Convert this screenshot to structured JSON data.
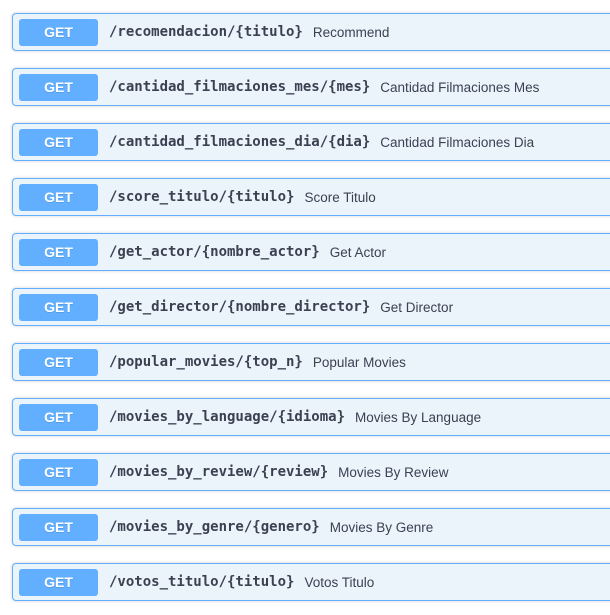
{
  "operations": [
    {
      "method": "GET",
      "path": "/recomendacion/{titulo}",
      "summary": "Recommend"
    },
    {
      "method": "GET",
      "path": "/cantidad_filmaciones_mes/{mes}",
      "summary": "Cantidad Filmaciones Mes"
    },
    {
      "method": "GET",
      "path": "/cantidad_filmaciones_dia/{dia}",
      "summary": "Cantidad Filmaciones Dia"
    },
    {
      "method": "GET",
      "path": "/score_titulo/{titulo}",
      "summary": "Score Titulo"
    },
    {
      "method": "GET",
      "path": "/get_actor/{nombre_actor}",
      "summary": "Get Actor"
    },
    {
      "method": "GET",
      "path": "/get_director/{nombre_director}",
      "summary": "Get Director"
    },
    {
      "method": "GET",
      "path": "/popular_movies/{top_n}",
      "summary": "Popular Movies"
    },
    {
      "method": "GET",
      "path": "/movies_by_language/{idioma}",
      "summary": "Movies By Language"
    },
    {
      "method": "GET",
      "path": "/movies_by_review/{review}",
      "summary": "Movies By Review"
    },
    {
      "method": "GET",
      "path": "/movies_by_genre/{genero}",
      "summary": "Movies By Genre"
    },
    {
      "method": "GET",
      "path": "/votos_titulo/{titulo}",
      "summary": "Votos Titulo"
    }
  ],
  "colors": {
    "get_accent": "#61affe",
    "get_background": "#ebf3fb",
    "text": "#3b4151"
  }
}
